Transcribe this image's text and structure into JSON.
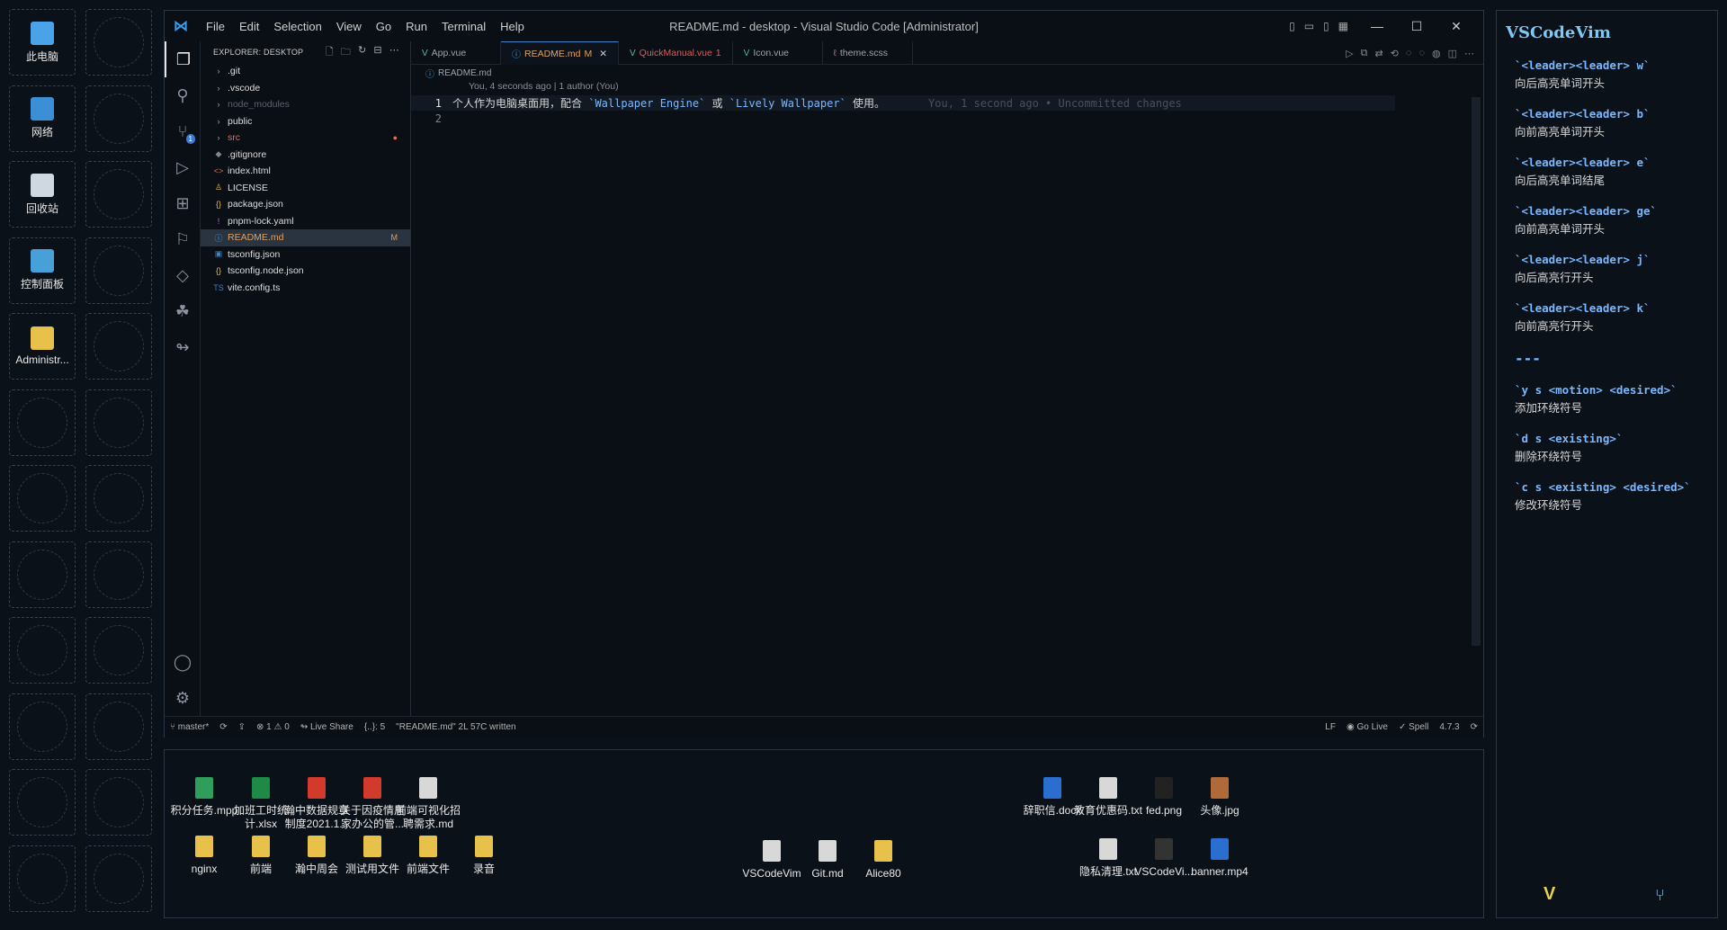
{
  "desktop_left_icons": [
    {
      "label": "此电脑",
      "icon": "computer-icon",
      "color": "#4aa3e8"
    },
    {
      "label": "网络",
      "icon": "network-globe-icon",
      "color": "#3c8fd6"
    },
    {
      "label": "回收站",
      "icon": "recycle-bin-icon",
      "color": "#cfd8e0"
    },
    {
      "label": "控制面板",
      "icon": "control-panel-icon",
      "color": "#48a0d8"
    },
    {
      "label": "Administr...",
      "icon": "user-folder-icon",
      "color": "#e8c14b"
    }
  ],
  "window": {
    "title": "README.md - desktop - Visual Studio Code [Administrator]",
    "menu": [
      "File",
      "Edit",
      "Selection",
      "View",
      "Go",
      "Run",
      "Terminal",
      "Help"
    ]
  },
  "activity_badge": "1",
  "explorer": {
    "header": "EXPLORER: DESKTOP",
    "items": [
      {
        "name": ".git",
        "kind": "folder",
        "color": "#dddddd"
      },
      {
        "name": ".vscode",
        "kind": "folder",
        "color": "#dddddd"
      },
      {
        "name": "node_modules",
        "kind": "folder",
        "color": "#5a6270"
      },
      {
        "name": "public",
        "kind": "folder",
        "color": "#dddddd"
      },
      {
        "name": "src",
        "kind": "folder",
        "color": "#e06c5a",
        "status": "●"
      },
      {
        "name": ".gitignore",
        "kind": "file",
        "icon": "◆",
        "icon_color": "#888",
        "color": "#dddddd"
      },
      {
        "name": "index.html",
        "kind": "file",
        "icon": "<>",
        "icon_color": "#e06c4a",
        "color": "#dddddd"
      },
      {
        "name": "LICENSE",
        "kind": "file",
        "icon": "♙",
        "icon_color": "#e0b84a",
        "color": "#dddddd"
      },
      {
        "name": "package.json",
        "kind": "file",
        "icon": "{}",
        "icon_color": "#e0c04a",
        "color": "#dddddd"
      },
      {
        "name": "pnpm-lock.yaml",
        "kind": "file",
        "icon": "!",
        "icon_color": "#b070e0",
        "color": "#dddddd"
      },
      {
        "name": "README.md",
        "kind": "file",
        "icon": "ⓘ",
        "icon_color": "#4aa0e0",
        "color": "#e0a15a",
        "status": "M",
        "selected": true
      },
      {
        "name": "tsconfig.json",
        "kind": "file",
        "icon": "▣",
        "icon_color": "#3b82c4",
        "color": "#dddddd"
      },
      {
        "name": "tsconfig.node.json",
        "kind": "file",
        "icon": "{}",
        "icon_color": "#e0c04a",
        "color": "#dddddd"
      },
      {
        "name": "vite.config.ts",
        "kind": "file",
        "icon": "TS",
        "icon_color": "#3b82c4",
        "color": "#dddddd"
      }
    ]
  },
  "tabs": [
    {
      "label": "App.vue",
      "icon": "V",
      "icon_color": "#4fc08d",
      "color": "#9aa3ae"
    },
    {
      "label": "README.md",
      "suffix": "M",
      "icon": "ⓘ",
      "icon_color": "#4aa0e0",
      "color": "#e0a15a",
      "active": true
    },
    {
      "label": "QuickManual.vue",
      "suffix": "1",
      "icon": "V",
      "icon_color": "#4fc08d",
      "color": "#e05a5a"
    },
    {
      "label": "Icon.vue",
      "icon": "V",
      "icon_color": "#4fc08d",
      "color": "#9aa3ae"
    },
    {
      "label": "theme.scss",
      "icon": "ℓ",
      "icon_color": "#e05a8a",
      "color": "#9aa3ae"
    }
  ],
  "breadcrumb": "README.md",
  "blame": "You, 4 seconds ago | 1 author (You)",
  "code": {
    "line1_num": "1",
    "line1_prefix": "个人作为电脑桌面用，配合 ",
    "line1_hl1": "`Wallpaper Engine`",
    "line1_mid": " 或 ",
    "line1_hl2": "`Lively Wallpaper`",
    "line1_suffix": " 使用。",
    "line1_ghost": "You, 1 second ago • Uncommitted changes",
    "line2_num": "2"
  },
  "status": {
    "branch": "master*",
    "problems": "⊗ 1 ⚠ 0",
    "liveshare": "Live Share",
    "braces": "{..}: 5",
    "message": "\"README.md\" 2L 57C written",
    "eol": "LF",
    "golive": "Go Live",
    "spell": "Spell",
    "version": "4.7.3"
  },
  "desktop_files": [
    {
      "label": "积分任务.mpp",
      "icon_color": "#2e9e5a"
    },
    {
      "label": "加班工时统计.xlsx",
      "icon_color": "#1f8a45"
    },
    {
      "label": "瀚中数据规章制度2021.1...",
      "icon_color": "#d23a2c"
    },
    {
      "label": "关于因疫情居家办公的管...",
      "icon_color": "#d23a2c"
    },
    {
      "label": "前端可视化招聘需求.md",
      "icon_color": "#d8d8d8"
    },
    {
      "label": "nginx",
      "icon_color": "#e8c14b"
    },
    {
      "label": "前端",
      "icon_color": "#e8c14b"
    },
    {
      "label": "瀚中周会",
      "icon_color": "#e8c14b"
    },
    {
      "label": "测试用文件",
      "icon_color": "#e8c14b"
    },
    {
      "label": "前端文件",
      "icon_color": "#e8c14b"
    },
    {
      "label": "录音",
      "icon_color": "#e8c14b"
    },
    {
      "label": "VSCodeVim",
      "icon_color": "#d8d8d8"
    },
    {
      "label": "Git.md",
      "icon_color": "#d8d8d8"
    },
    {
      "label": "Alice80",
      "icon_color": "#e8c14b"
    },
    {
      "label": "辞职信.docx",
      "icon_color": "#2a6fd0"
    },
    {
      "label": "教育优惠码.txt",
      "icon_color": "#d8d8d8"
    },
    {
      "label": "fed.png",
      "icon_color": "#222"
    },
    {
      "label": "头像.jpg",
      "icon_color": "#b06a3a"
    },
    {
      "label": "隐私清理.txt",
      "icon_color": "#d8d8d8"
    },
    {
      "label": "VSCodeVi...",
      "icon_color": "#333"
    },
    {
      "label": "banner.mp4",
      "icon_color": "#2a6fd0"
    }
  ],
  "vim_panel": {
    "title": "VSCodeVim",
    "items_a": [
      {
        "key": "`<leader><leader> w`",
        "desc": "向后高亮单词开头"
      },
      {
        "key": "`<leader><leader> b`",
        "desc": "向前高亮单词开头"
      },
      {
        "key": "`<leader><leader> e`",
        "desc": "向后高亮单词结尾"
      },
      {
        "key": "`<leader><leader> ge`",
        "desc": "向前高亮单词开头"
      },
      {
        "key": "`<leader><leader> j`",
        "desc": "向后高亮行开头"
      },
      {
        "key": "`<leader><leader> k`",
        "desc": "向前高亮行开头"
      }
    ],
    "divider": "---",
    "items_b": [
      {
        "key": "`y s <motion> <desired>`",
        "desc": "添加环绕符号"
      },
      {
        "key": "`d s <existing>`",
        "desc": "删除环绕符号"
      },
      {
        "key": "`c s <existing> <desired>`",
        "desc": "修改环绕符号"
      }
    ]
  }
}
